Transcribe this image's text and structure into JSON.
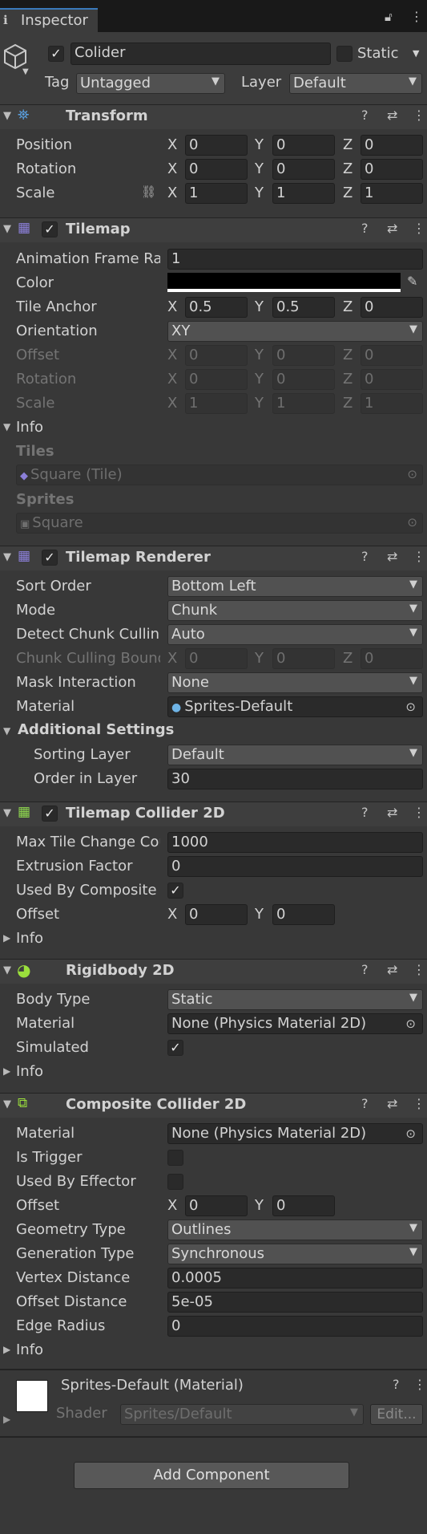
{
  "tab": {
    "label": "Inspector"
  },
  "header": {
    "object_name": "Colider",
    "static_label": "Static",
    "tag_label": "Tag",
    "tag_value": "Untagged",
    "layer_label": "Layer",
    "layer_value": "Default"
  },
  "transform": {
    "title": "Transform",
    "position_label": "Position",
    "position": [
      "0",
      "0",
      "0"
    ],
    "rotation_label": "Rotation",
    "rotation": [
      "0",
      "0",
      "0"
    ],
    "scale_label": "Scale",
    "scale": [
      "1",
      "1",
      "1"
    ]
  },
  "axes": {
    "x": "X",
    "y": "Y",
    "z": "Z"
  },
  "tilemap": {
    "title": "Tilemap",
    "anim_label": "Animation Frame Rate",
    "anim_value": "1",
    "color_label": "Color",
    "anchor_label": "Tile Anchor",
    "anchor": [
      "0.5",
      "0.5",
      "0"
    ],
    "orientation_label": "Orientation",
    "orientation_value": "XY",
    "offset_label": "Offset",
    "offset": [
      "0",
      "0",
      "0"
    ],
    "rotation_label": "Rotation",
    "rotation": [
      "0",
      "0",
      "0"
    ],
    "scale_label": "Scale",
    "scale": [
      "1",
      "1",
      "1"
    ],
    "info_label": "Info",
    "tiles_label": "Tiles",
    "tiles_value": "Square (Tile)",
    "sprites_label": "Sprites",
    "sprites_value": "Square"
  },
  "renderer": {
    "title": "Tilemap Renderer",
    "sort_label": "Sort Order",
    "sort_value": "Bottom Left",
    "mode_label": "Mode",
    "mode_value": "Chunk",
    "detect_label": "Detect Chunk Culling Bounds",
    "detect_value": "Auto",
    "bounds_label": "Chunk Culling Bounds",
    "bounds": [
      "0",
      "0",
      "0"
    ],
    "mask_label": "Mask Interaction",
    "mask_value": "None",
    "material_label": "Material",
    "material_value": "Sprites-Default",
    "additional_label": "Additional Settings",
    "sorting_layer_label": "Sorting Layer",
    "sorting_layer_value": "Default",
    "order_label": "Order in Layer",
    "order_value": "30"
  },
  "collider": {
    "title": "Tilemap Collider 2D",
    "max_label": "Max Tile Change Count",
    "max_value": "1000",
    "extrusion_label": "Extrusion Factor",
    "extrusion_value": "0",
    "composite_label": "Used By Composite",
    "offset_label": "Offset",
    "offset": [
      "0",
      "0"
    ],
    "info_label": "Info"
  },
  "rigidbody": {
    "title": "Rigidbody 2D",
    "body_label": "Body Type",
    "body_value": "Static",
    "material_label": "Material",
    "material_value": "None (Physics Material 2D)",
    "simulated_label": "Simulated",
    "info_label": "Info"
  },
  "composite": {
    "title": "Composite Collider 2D",
    "material_label": "Material",
    "material_value": "None (Physics Material 2D)",
    "trigger_label": "Is Trigger",
    "effector_label": "Used By Effector",
    "offset_label": "Offset",
    "offset": [
      "0",
      "0"
    ],
    "geometry_label": "Geometry Type",
    "geometry_value": "Outlines",
    "generation_label": "Generation Type",
    "generation_value": "Synchronous",
    "vertex_label": "Vertex Distance",
    "vertex_value": "0.0005",
    "offsetdist_label": "Offset Distance",
    "offsetdist_value": "5e-05",
    "edge_label": "Edge Radius",
    "edge_value": "0",
    "info_label": "Info"
  },
  "material_panel": {
    "title": "Sprites-Default (Material)",
    "shader_label": "Shader",
    "shader_value": "Sprites/Default",
    "edit_label": "Edit..."
  },
  "add_component_label": "Add Component",
  "colors": {
    "background": "#383838",
    "field": "#2a2a2a",
    "accent": "#3a79bb",
    "tilemap_color": "#000000"
  }
}
